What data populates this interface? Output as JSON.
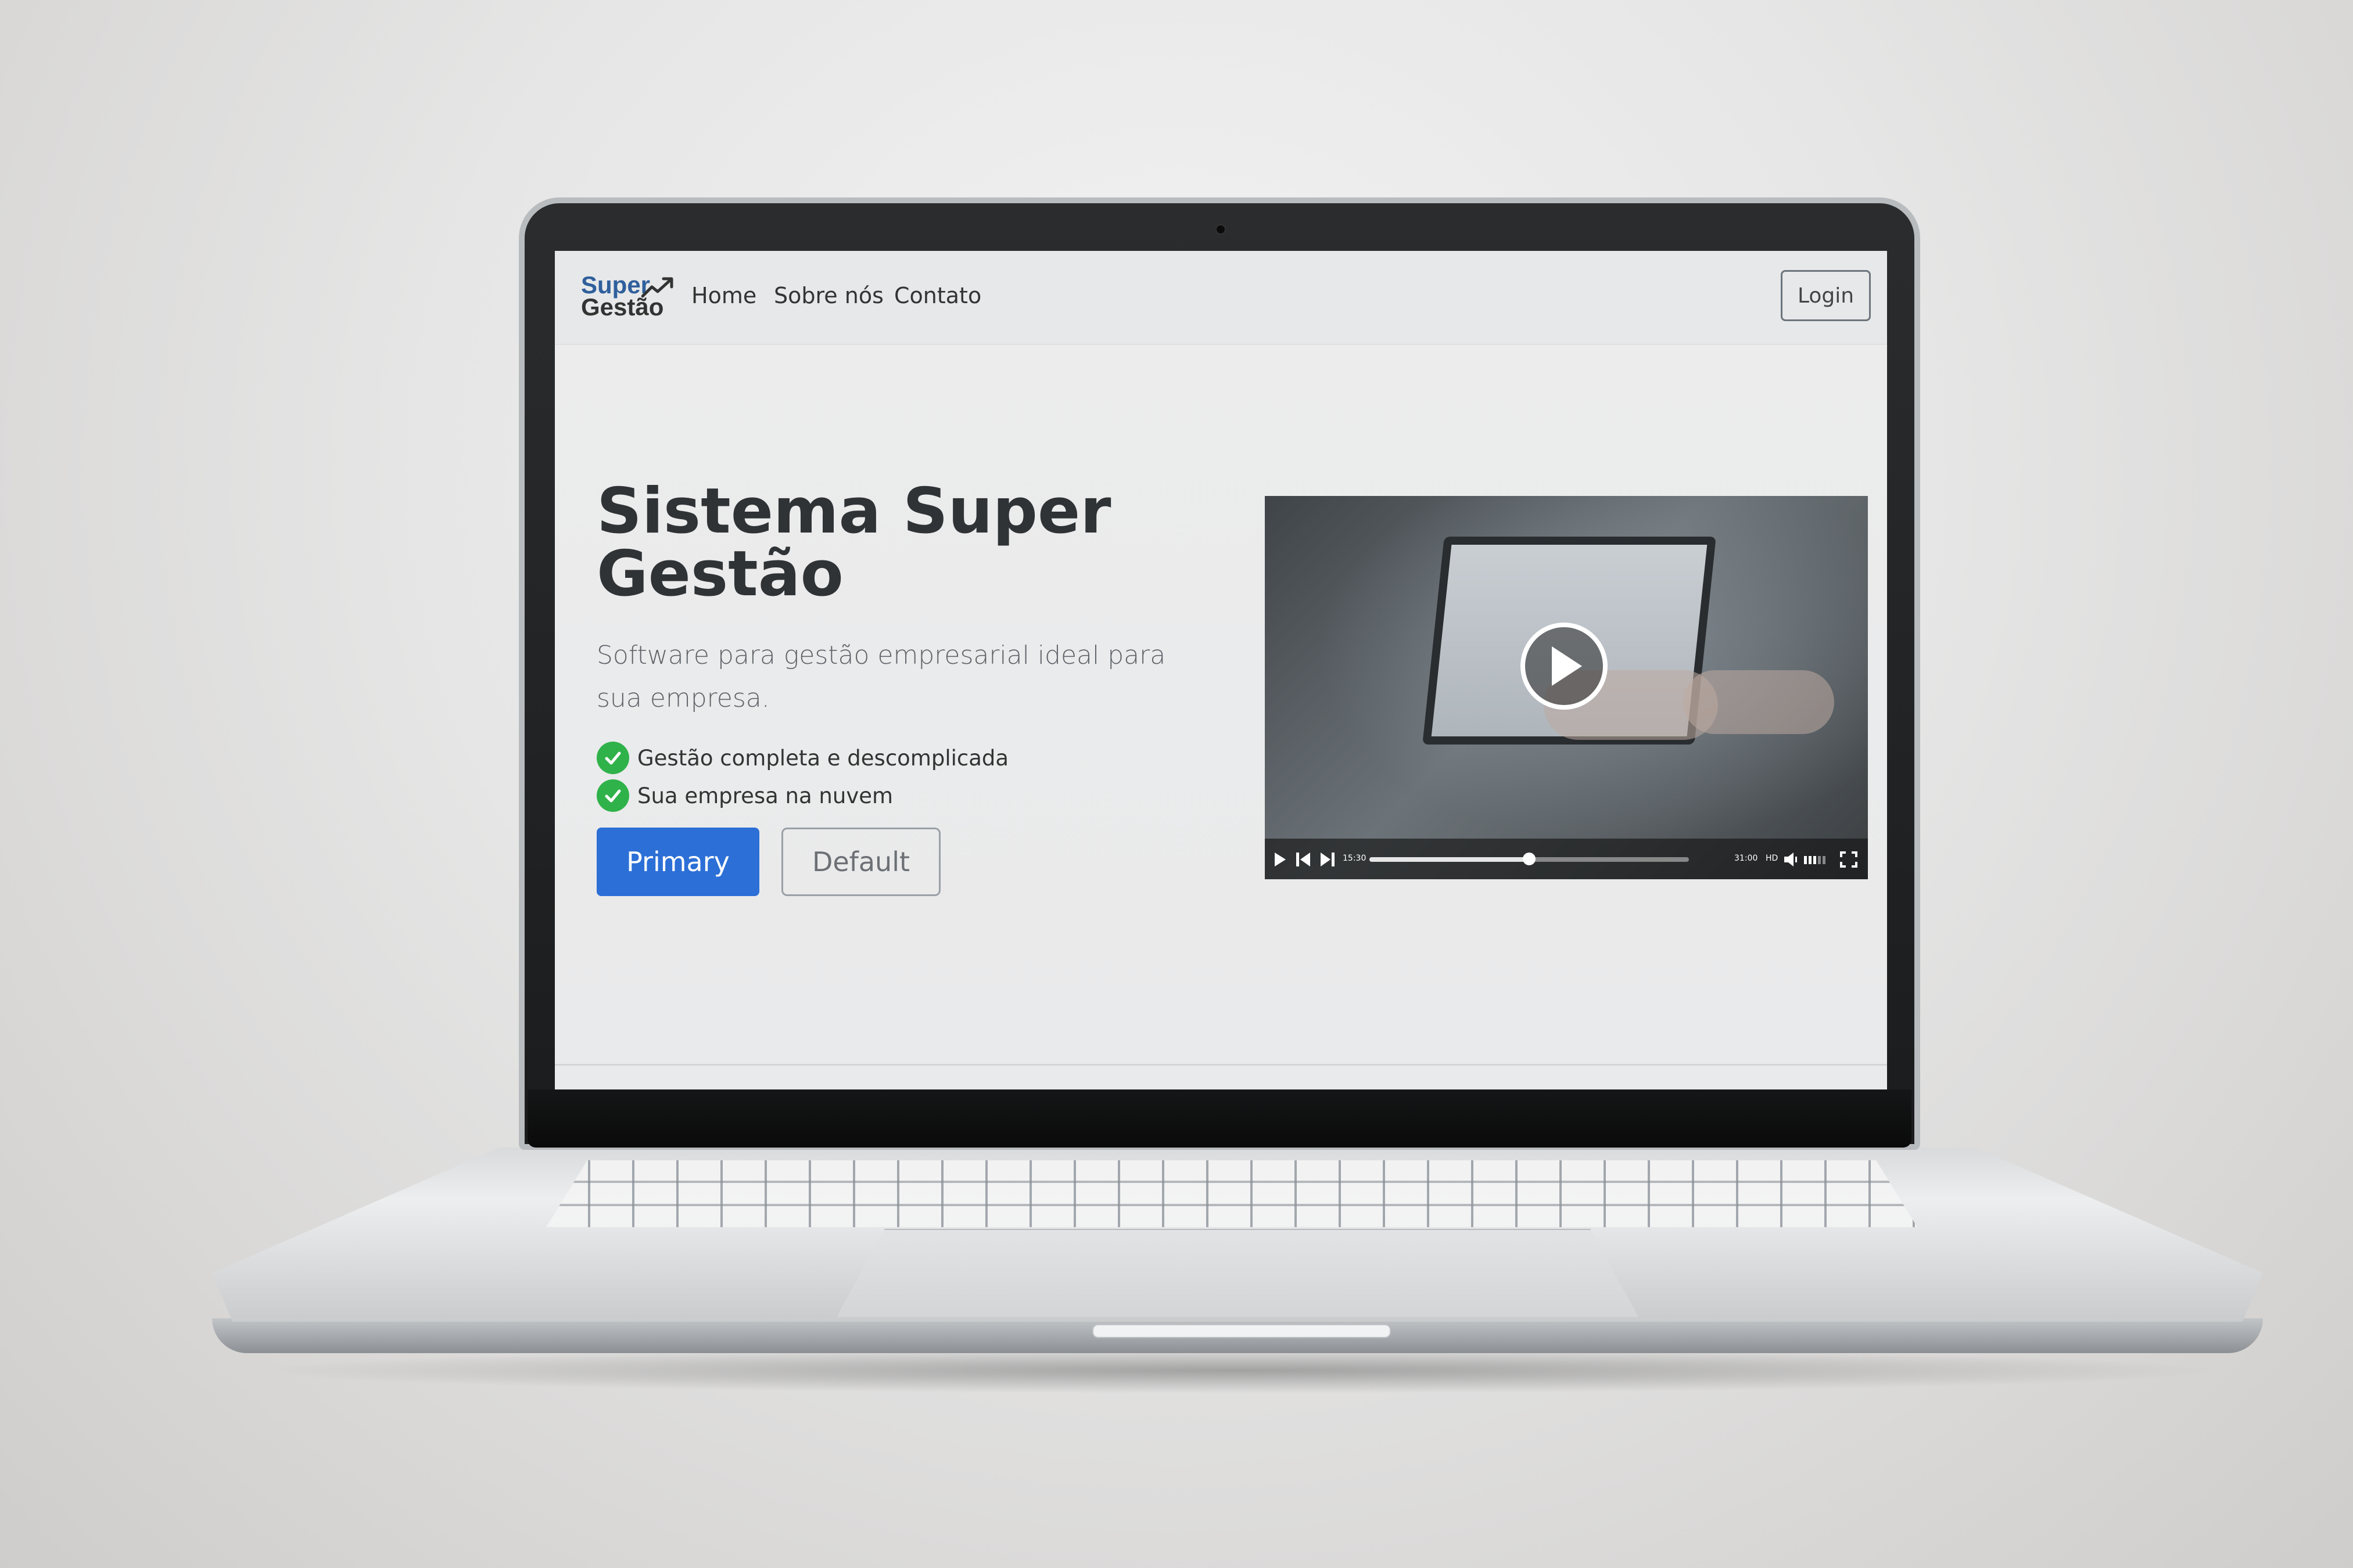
{
  "navbar": {
    "logo": {
      "line1": "Super",
      "line2": "Gestão",
      "colors": {
        "super": "#2f5f9c",
        "gestao": "#333333"
      },
      "icon": "trend-arrow-icon"
    },
    "links": [
      "Home",
      "Sobre nós",
      "Contato"
    ],
    "login_label": "Login"
  },
  "hero": {
    "title": "Sistema Super Gestão",
    "subtitle": "Software para gestão empresarial ideal para sua empresa.",
    "features": [
      "Gestão completa e descomplicada",
      "Sua empresa na nuvem"
    ],
    "feature_icon": "check-circle-icon",
    "primary_label": "Primary",
    "default_label": "Default",
    "colors": {
      "primary": "#2c6fd6",
      "check": "#2fb24a"
    }
  },
  "video": {
    "current_time": "15:30",
    "duration": "31:00",
    "quality": "HD",
    "progress": 0.5,
    "icons": [
      "play-icon",
      "skip-back-icon",
      "skip-forward-icon",
      "volume-icon",
      "fullscreen-icon"
    ]
  }
}
